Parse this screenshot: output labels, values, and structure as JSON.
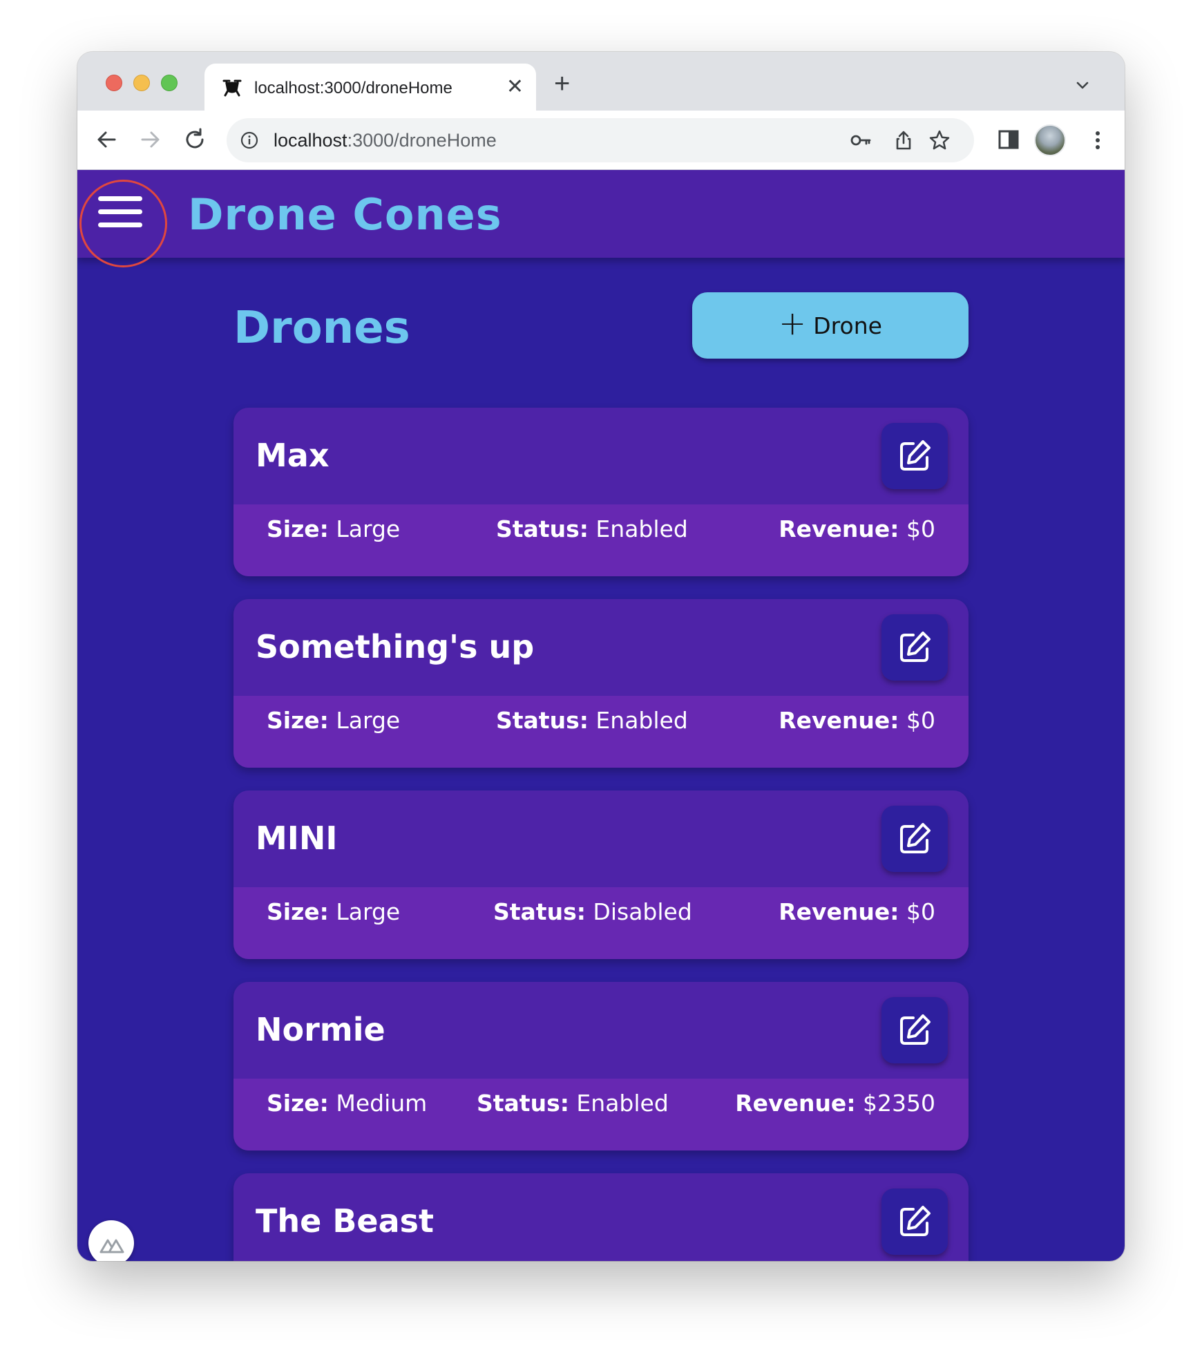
{
  "browser": {
    "tab_title": "localhost:3000/droneHome",
    "tab_close": "✕",
    "new_tab": "+",
    "url_host": "localhost",
    "url_path": ":3000/droneHome"
  },
  "header": {
    "app_title": "Drone Cones"
  },
  "main": {
    "heading": "Drones",
    "add_button_plus": "+",
    "add_button_label": "Drone"
  },
  "labels": {
    "size": "Size:",
    "status": "Status:",
    "revenue": "Revenue:"
  },
  "drones": [
    {
      "name": "Max",
      "size": "Large",
      "status": "Enabled",
      "revenue": "$0"
    },
    {
      "name": "Something's up",
      "size": "Large",
      "status": "Enabled",
      "revenue": "$0"
    },
    {
      "name": "MINI",
      "size": "Large",
      "status": "Disabled",
      "revenue": "$0"
    },
    {
      "name": "Normie",
      "size": "Medium",
      "status": "Enabled",
      "revenue": "$2350"
    },
    {
      "name": "The Beast"
    }
  ],
  "colors": {
    "header_bg": "#4c22a6",
    "page_bg": "#2e1f9e",
    "accent": "#6dc6ee",
    "card_bg": "#4e23a8",
    "card_stats_bg": "#6728b2",
    "focus_ring": "#e0473f"
  },
  "icons": [
    "drone-favicon-icon",
    "info-icon",
    "key-icon",
    "share-icon",
    "star-icon",
    "side-panel-icon",
    "menu-icon",
    "edit-icon",
    "nuxt-icon"
  ]
}
